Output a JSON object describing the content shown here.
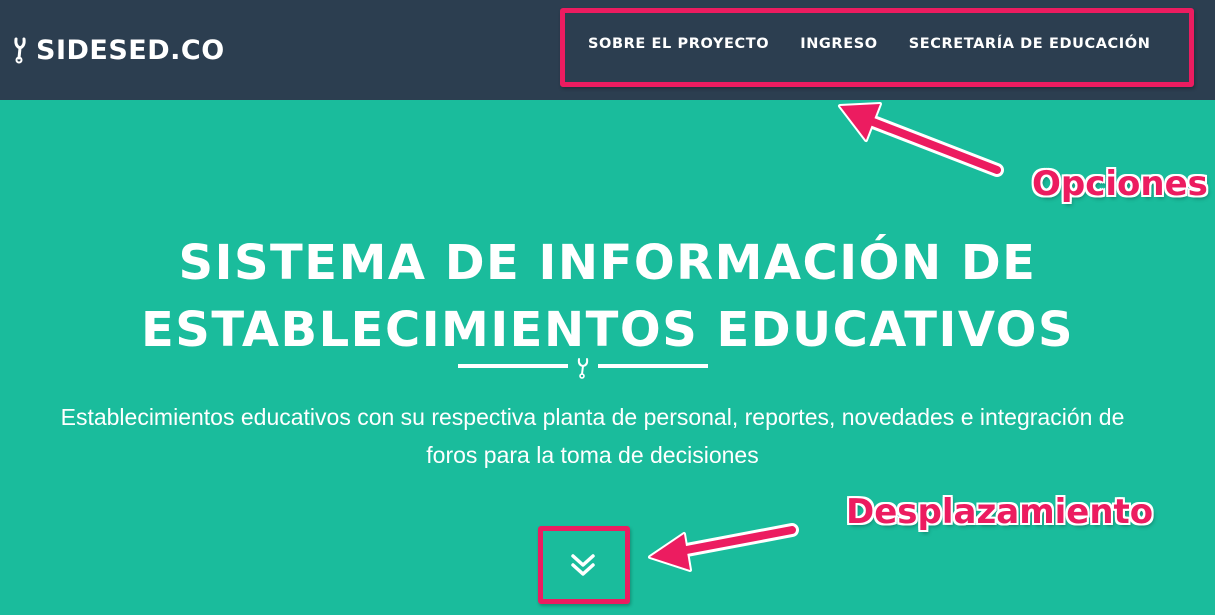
{
  "navbar": {
    "brand": "SIDESED.CO",
    "brand_icon": "tuning-fork-icon",
    "links": [
      {
        "label": "SOBRE EL PROYECTO"
      },
      {
        "label": "INGRESO"
      },
      {
        "label": "SECRETARÍA DE EDUCACIÓN"
      }
    ]
  },
  "hero": {
    "title_line1": "SISTEMA DE INFORMACIÓN DE",
    "title_line2": "ESTABLECIMIENTOS EDUCATIVOS",
    "divider_icon": "tuning-fork-icon",
    "description_line1": "Establecimientos educativos con su respectiva planta de personal, reportes, novedades e integración de",
    "description_line2": "foros para la toma de decisiones",
    "scroll_icon": "double-chevron-down-icon"
  },
  "annotations": {
    "options": "Opciones",
    "scroll": "Desplazamiento"
  },
  "colors": {
    "navbar_bg": "#2c3e50",
    "hero_bg": "#1abc9c",
    "highlight": "#ec1c60",
    "text": "#ffffff"
  }
}
